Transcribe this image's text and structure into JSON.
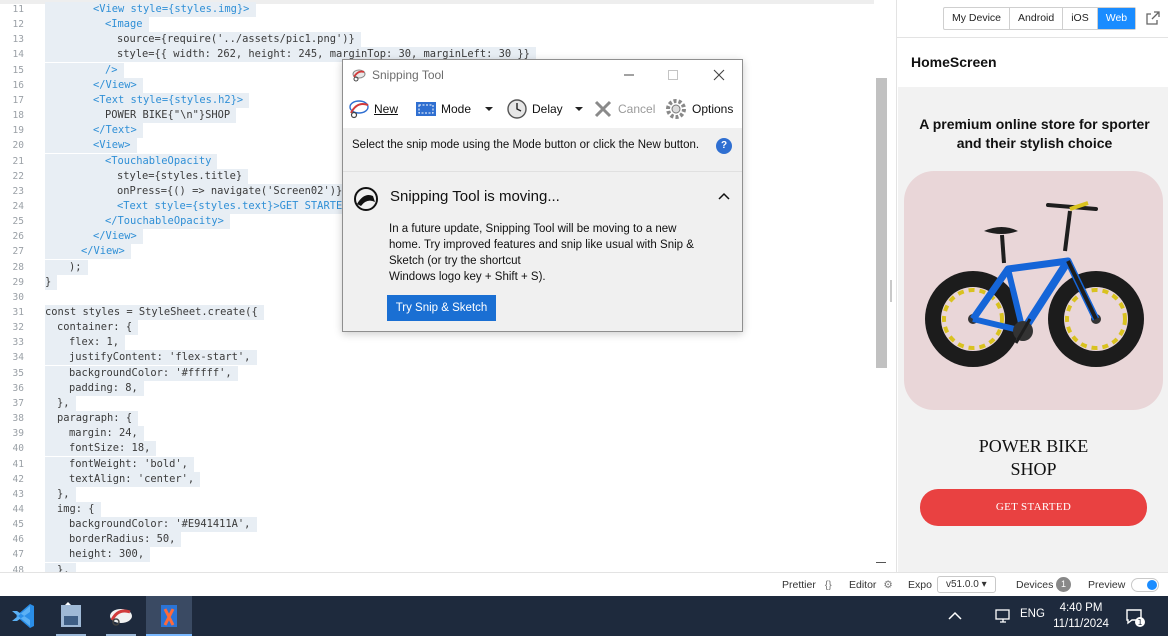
{
  "editor": {
    "lines": [
      {
        "n": "11",
        "code": "<View style={styles.img}>"
      },
      {
        "n": "12",
        "code": "<Image"
      },
      {
        "n": "13",
        "code": "source={require('../assets/pic1.png')}"
      },
      {
        "n": "14",
        "code": "style={{ width: 262, height: 245, marginTop: 30, marginLeft: 30 }}"
      },
      {
        "n": "15",
        "code": "/>"
      },
      {
        "n": "16",
        "code": "</View>"
      },
      {
        "n": "17",
        "code": "<Text style={styles.h2}>"
      },
      {
        "n": "18",
        "code": "POWER BIKE{\"\\n\"}SHOP"
      },
      {
        "n": "19",
        "code": "</Text>"
      },
      {
        "n": "20",
        "code": "<View>"
      },
      {
        "n": "21",
        "code": "<TouchableOpacity"
      },
      {
        "n": "22",
        "code": "style={styles.title}"
      },
      {
        "n": "23",
        "code": "onPress={() => navigate('Screen02')}>"
      },
      {
        "n": "24",
        "code": "<Text style={styles.text}>GET STARTED</T"
      },
      {
        "n": "25",
        "code": "</TouchableOpacity>"
      },
      {
        "n": "26",
        "code": "</View>"
      },
      {
        "n": "27",
        "code": "</View>"
      },
      {
        "n": "28",
        "code": ");"
      },
      {
        "n": "29",
        "code": "}"
      },
      {
        "n": "30",
        "code": ""
      },
      {
        "n": "31",
        "code": "const styles = StyleSheet.create({"
      },
      {
        "n": "32",
        "code": "container: {"
      },
      {
        "n": "33",
        "code": "flex: 1,"
      },
      {
        "n": "34",
        "code": "justifyContent: 'flex-start',"
      },
      {
        "n": "35",
        "code": "backgroundColor: '#fffff',"
      },
      {
        "n": "36",
        "code": "padding: 8,"
      },
      {
        "n": "37",
        "code": "},"
      },
      {
        "n": "38",
        "code": "paragraph: {"
      },
      {
        "n": "39",
        "code": "margin: 24,"
      },
      {
        "n": "40",
        "code": "fontSize: 18,"
      },
      {
        "n": "41",
        "code": "fontWeight: 'bold',"
      },
      {
        "n": "42",
        "code": "textAlign: 'center',"
      },
      {
        "n": "43",
        "code": "},"
      },
      {
        "n": "44",
        "code": "img: {"
      },
      {
        "n": "45",
        "code": "backgroundColor: '#E941411A',"
      },
      {
        "n": "46",
        "code": "borderRadius: 50,"
      },
      {
        "n": "47",
        "code": "height: 300,"
      },
      {
        "n": "48",
        "code": "},"
      }
    ]
  },
  "preview": {
    "device_tabs": [
      "My Device",
      "Android",
      "iOS",
      "Web"
    ],
    "active_tab": "Web",
    "screen_title": "HomeScreen",
    "paragraph": "A premium online store for sporter and their stylish choice",
    "bike_title_line1": "POWER BIKE",
    "bike_title_line2": "SHOP",
    "cta_label": "GET STARTED",
    "card_color": "#E941411A",
    "cta_color": "#E94141"
  },
  "status_bar": {
    "prettier": "Prettier",
    "editor": "Editor",
    "expo": "Expo",
    "expo_version": "v51.0.0 ▾",
    "devices": "Devices",
    "devices_count": "1",
    "preview": "Preview"
  },
  "snipping_tool": {
    "title": "Snipping Tool",
    "toolbar": {
      "new": "New",
      "mode": "Mode",
      "delay": "Delay",
      "cancel": "Cancel",
      "options": "Options"
    },
    "info": "Select the snip mode using the Mode button or click the New button.",
    "help": "?",
    "notice_title": "Snipping Tool is moving...",
    "notice_body_1": "In a future update, Snipping Tool will be moving to a new home. Try improved features and snip like usual with Snip & Sketch (or try the shortcut",
    "notice_body_2": "Windows logo key + Shift + S).",
    "try_button": "Try Snip & Sketch"
  },
  "taskbar": {
    "apps": [
      "vscode-icon",
      "notepad-icon",
      "snipping-tool-icon",
      "snip-sketch-icon"
    ],
    "language": "ENG",
    "time": "4:40 PM",
    "date": "11/11/2024",
    "notification_count": "1"
  }
}
